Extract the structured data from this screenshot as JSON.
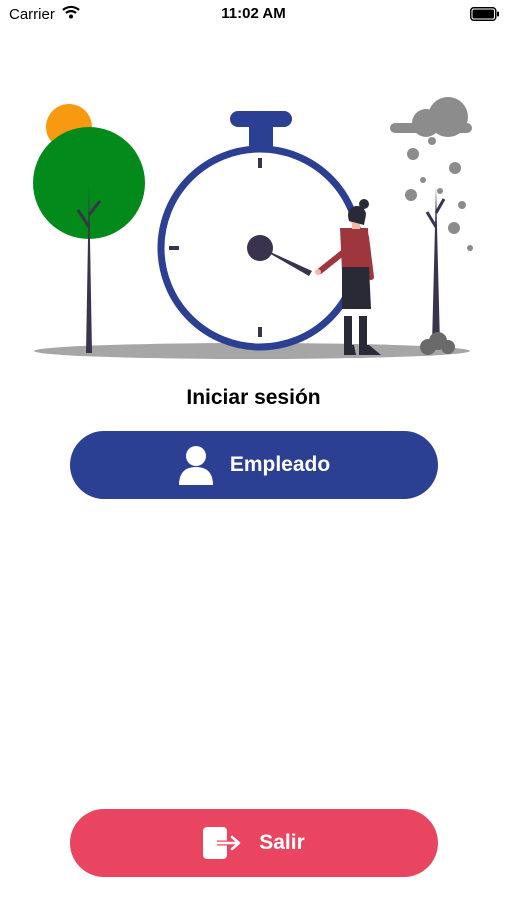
{
  "status_bar": {
    "carrier": "Carrier",
    "time": "11:02 AM",
    "icons": [
      "wifi-icon",
      "battery-icon"
    ]
  },
  "login": {
    "title": "Iniciar sesión",
    "employee_button": "Empleado",
    "exit_button": "Salir"
  },
  "colors": {
    "primary": "#2b3f93",
    "danger": "#ea4560",
    "tree_green": "#028a1a",
    "sun_orange": "#f79a12"
  }
}
